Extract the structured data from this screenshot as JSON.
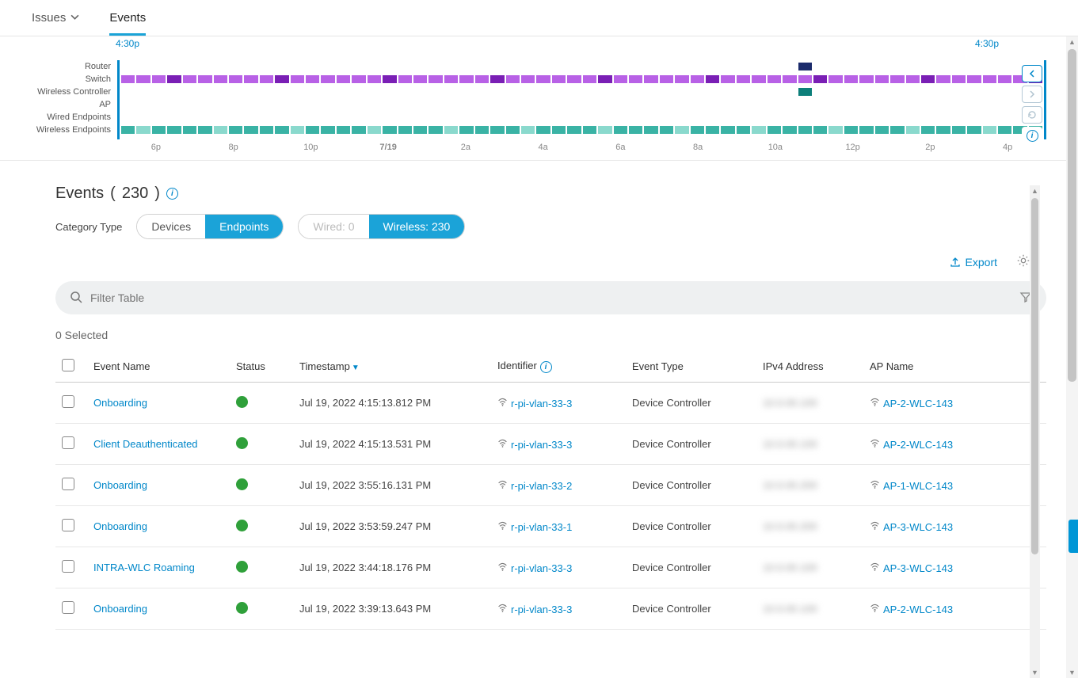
{
  "tabs": {
    "issues": "Issues",
    "events": "Events"
  },
  "timeline": {
    "start_label": "4:30p",
    "end_label": "4:30p",
    "lanes": [
      "Router",
      "Switch",
      "Wireless Controller",
      "AP",
      "Wired Endpoints",
      "Wireless Endpoints"
    ],
    "axis": [
      "6p",
      "8p",
      "10p",
      "7/19",
      "2a",
      "4a",
      "6a",
      "8a",
      "10a",
      "12p",
      "2p",
      "4p"
    ]
  },
  "events": {
    "title_prefix": "Events",
    "count": "230",
    "category_label": "Category Type",
    "pills1": {
      "devices": "Devices",
      "endpoints": "Endpoints"
    },
    "pills2": {
      "wired": "Wired: 0",
      "wireless": "Wireless: 230"
    },
    "export_label": "Export",
    "search_placeholder": "Filter Table",
    "selected": "0 Selected",
    "columns": {
      "event_name": "Event Name",
      "status": "Status",
      "timestamp": "Timestamp",
      "identifier": "Identifier",
      "event_type": "Event Type",
      "ipv4": "IPv4 Address",
      "ap": "AP Name"
    },
    "rows": [
      {
        "event": "Onboarding",
        "ts": "Jul 19, 2022 4:15:13.812 PM",
        "id": "r-pi-vlan-33-3",
        "type": "Device Controller",
        "ip": "10.0.00.100",
        "ap": "AP-2-WLC-143"
      },
      {
        "event": "Client Deauthenticated",
        "ts": "Jul 19, 2022 4:15:13.531 PM",
        "id": "r-pi-vlan-33-3",
        "type": "Device Controller",
        "ip": "10.0.00.100",
        "ap": "AP-2-WLC-143"
      },
      {
        "event": "Onboarding",
        "ts": "Jul 19, 2022 3:55:16.131 PM",
        "id": "r-pi-vlan-33-2",
        "type": "Device Controller",
        "ip": "10.0.00.200",
        "ap": "AP-1-WLC-143"
      },
      {
        "event": "Onboarding",
        "ts": "Jul 19, 2022 3:53:59.247 PM",
        "id": "r-pi-vlan-33-1",
        "type": "Device Controller",
        "ip": "10.0.00.200",
        "ap": "AP-3-WLC-143"
      },
      {
        "event": "INTRA-WLC Roaming",
        "ts": "Jul 19, 2022 3:44:18.176 PM",
        "id": "r-pi-vlan-33-3",
        "type": "Device Controller",
        "ip": "10.0.00.100",
        "ap": "AP-3-WLC-143"
      },
      {
        "event": "Onboarding",
        "ts": "Jul 19, 2022 3:39:13.643 PM",
        "id": "r-pi-vlan-33-3",
        "type": "Device Controller",
        "ip": "10.0.00.100",
        "ap": "AP-2-WLC-143"
      }
    ]
  }
}
